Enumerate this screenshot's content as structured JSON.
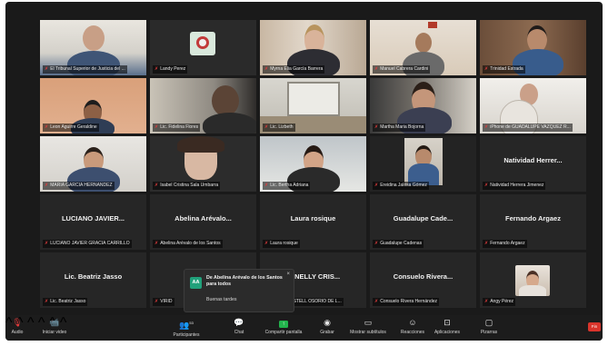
{
  "participants": [
    {
      "caption": "El Tribunal Superior de Justicia del ...",
      "big_name": "",
      "active": false
    },
    {
      "caption": "Landy Perez",
      "big_name": "",
      "active": false
    },
    {
      "caption": "Myrna Elia García Barrera",
      "big_name": "",
      "active": true
    },
    {
      "caption": "Manuel Cabrera Cardini",
      "big_name": "",
      "active": false
    },
    {
      "caption": "Trinidad Estrada",
      "big_name": "",
      "active": false
    },
    {
      "caption": "Leon Aguirre Geraldine",
      "big_name": "",
      "active": false
    },
    {
      "caption": "Lic. Fidelina Flores",
      "big_name": "",
      "active": false
    },
    {
      "caption": "Lic. Lizbeth",
      "big_name": "",
      "active": false
    },
    {
      "caption": "Martha Maria Bojorna",
      "big_name": "",
      "active": false
    },
    {
      "caption": "iPhone de GUADALUPE VAZQUEZ R...",
      "big_name": "",
      "active": false
    },
    {
      "caption": "MARIA GARCIA HERNANDEZ",
      "big_name": "",
      "active": false
    },
    {
      "caption": "Isabel Cristina Sala Umbarra",
      "big_name": "",
      "active": false
    },
    {
      "caption": "Lic. Bertha Adriana",
      "big_name": "",
      "active": false
    },
    {
      "caption": "Ereidina Jalosa Gómez",
      "big_name": "",
      "active": false
    },
    {
      "caption": "Natividad Herrera Jimenez",
      "big_name": "Natividad Herrer...",
      "active": false
    },
    {
      "caption": "LUCIANO JAVIER GRACIA CARRILLO",
      "big_name": "LUCIANO JAVIER...",
      "active": false
    },
    {
      "caption": "Abelina Arévalo de los Santos",
      "big_name": "Abelina Arévalo...",
      "active": false
    },
    {
      "caption": "Laura rosique",
      "big_name": "Laura rosique",
      "active": false
    },
    {
      "caption": "Guadalupe Cadenas",
      "big_name": "Guadalupe Cade...",
      "active": false
    },
    {
      "caption": "Fernando Argaez",
      "big_name": "Fernando Argaez",
      "active": false
    },
    {
      "caption": "Lic. Beatriz Jasso",
      "big_name": "Lic. Beatriz Jasso",
      "active": false
    },
    {
      "caption": "VIRID",
      "big_name": "",
      "active": false
    },
    {
      "caption": "NELLY CRISTELL OSORIO DE L...",
      "big_name": "E. NELLY CRIS...",
      "active": false
    },
    {
      "caption": "Consuelo Rivera Hernández",
      "big_name": "Consuelo Rivera...",
      "active": false
    },
    {
      "caption": "Angy Pérez",
      "big_name": "",
      "active": false
    }
  ],
  "chat_popup": {
    "avatar": "AA",
    "from": "De Abelina Arévalo de los Santos para todos",
    "message": "Buenas tardes",
    "close": "×"
  },
  "toolbar": {
    "audio": "Audio",
    "video": "Iniciar video",
    "participants": "Participantes",
    "participants_count": "53",
    "chat": "Chat",
    "share": "Compartir pantalla",
    "record": "Grabar",
    "subtitles": "Mostrar subtítulos",
    "reactions": "Reacciones",
    "apps": "Aplicaciones",
    "whiteboards": "Pizarras",
    "end": "Fin"
  },
  "colors": {
    "active_outline": "#d9d23b",
    "mute": "#e23b3b",
    "share": "#22b34c",
    "end": "#d9342b"
  }
}
